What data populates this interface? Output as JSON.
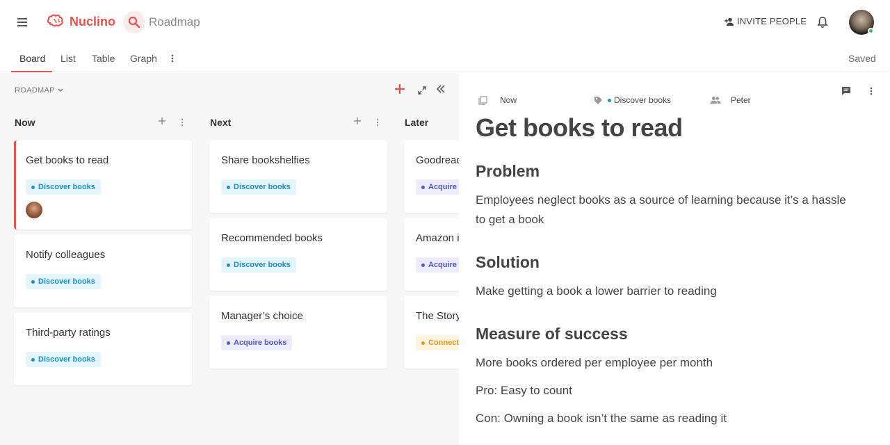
{
  "header": {
    "app_name": "Nuclino",
    "workspace": "Roadmap",
    "invite_label": "INVITE PEOPLE"
  },
  "tabs": {
    "items": [
      {
        "label": "Board"
      },
      {
        "label": "List"
      },
      {
        "label": "Table"
      },
      {
        "label": "Graph"
      }
    ],
    "active": "Board",
    "status": "Saved"
  },
  "board": {
    "collection_label": "ROADMAP",
    "columns": [
      {
        "title": "Now",
        "cards": [
          {
            "title": "Get books to read",
            "tag": "Discover books",
            "tag_type": "discover",
            "has_avatar": true,
            "selected": true
          },
          {
            "title": "Notify colleagues",
            "tag": "Discover books",
            "tag_type": "discover"
          },
          {
            "title": "Third-party ratings",
            "tag": "Discover books",
            "tag_type": "discover"
          }
        ]
      },
      {
        "title": "Next",
        "cards": [
          {
            "title": "Share bookshelfies",
            "tag": "Discover books",
            "tag_type": "discover"
          },
          {
            "title": "Recommended books",
            "tag": "Discover books",
            "tag_type": "discover"
          },
          {
            "title": "Manager’s choice",
            "tag": "Acquire books",
            "tag_type": "acquire"
          }
        ]
      },
      {
        "title": "Later",
        "cards": [
          {
            "title": "Goodreads",
            "tag": "Acquire books",
            "tag_type": "acquire"
          },
          {
            "title": "Amazon i",
            "tag": "Acquire books",
            "tag_type": "acquire"
          },
          {
            "title": "The Story",
            "tag": "Connect",
            "tag_type": "connect"
          }
        ]
      }
    ]
  },
  "detail": {
    "column": "Now",
    "tag": "Discover books",
    "assignee": "Peter",
    "title": "Get books to read",
    "sections": [
      {
        "heading": "Problem",
        "paragraphs": [
          "Employees neglect books as a source of learning because it’s a hassle to get a book"
        ]
      },
      {
        "heading": "Solution",
        "paragraphs": [
          "Make getting a book a lower barrier to reading"
        ]
      },
      {
        "heading": "Measure of success",
        "paragraphs": [
          "More books ordered per employee per month",
          "Pro: Easy to count",
          "Con: Owning a book isn’t the same as reading it"
        ]
      }
    ]
  },
  "colors": {
    "accent": "#e8534f",
    "discover": "#1d8fc4",
    "acquire": "#5656c8",
    "connect": "#e29a1a",
    "online": "#4cc06a"
  },
  "icons": [
    "menu-icon",
    "brain-logo-icon",
    "search-icon",
    "add-person-icon",
    "bell-icon",
    "more-vert-icon",
    "chevron-down-icon",
    "plus-icon",
    "expand-icon",
    "collapse-icon",
    "doc-icon",
    "tag-icon",
    "people-icon",
    "comment-icon"
  ]
}
